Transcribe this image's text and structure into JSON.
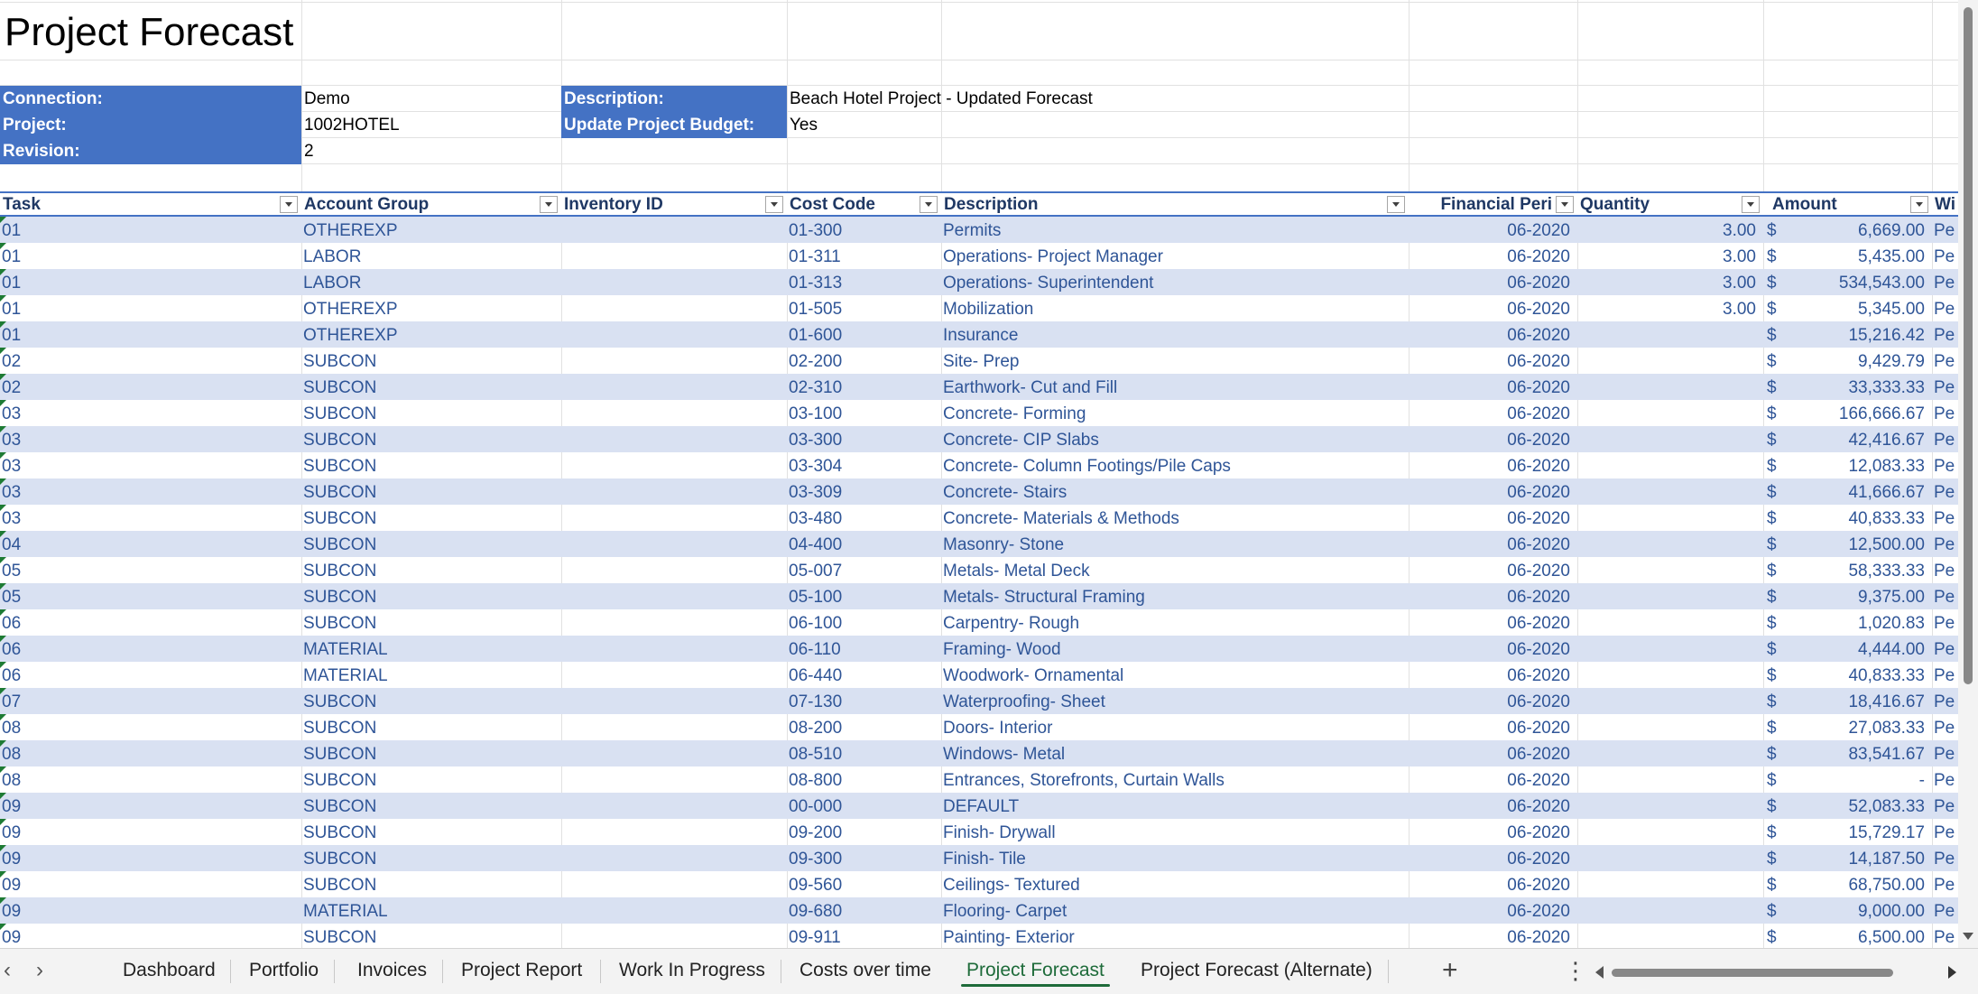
{
  "title": "Project Forecast",
  "info": {
    "connection_label": "Connection:",
    "connection_value": "Demo",
    "project_label": "Project:",
    "project_value": "1002HOTEL",
    "revision_label": "Revision:",
    "revision_value": "2",
    "description_label": "Description:",
    "description_value": "Beach Hotel Project - Updated Forecast",
    "update_budget_label": "Update Project Budget:",
    "update_budget_value": "Yes"
  },
  "table": {
    "headers": [
      "Task",
      "Account Group",
      "Inventory ID",
      "Cost Code",
      "Description",
      "Financial Peri",
      "Quantity",
      "Amount",
      "Wi"
    ],
    "currency_symbol": "$",
    "rows": [
      {
        "task": "01",
        "group": "OTHEREXP",
        "inv": "",
        "code": "01-300",
        "desc": "Permits",
        "period": "06-2020",
        "qty": "3.00",
        "amount": "6,669.00",
        "w": "Pe"
      },
      {
        "task": "01",
        "group": "LABOR",
        "inv": "",
        "code": "01-311",
        "desc": "Operations- Project Manager",
        "period": "06-2020",
        "qty": "3.00",
        "amount": "5,435.00",
        "w": "Pe"
      },
      {
        "task": "01",
        "group": "LABOR",
        "inv": "",
        "code": "01-313",
        "desc": "Operations- Superintendent",
        "period": "06-2020",
        "qty": "3.00",
        "amount": "534,543.00",
        "w": "Pe"
      },
      {
        "task": "01",
        "group": "OTHEREXP",
        "inv": "",
        "code": "01-505",
        "desc": "Mobilization",
        "period": "06-2020",
        "qty": "3.00",
        "amount": "5,345.00",
        "w": "Pe"
      },
      {
        "task": "01",
        "group": "OTHEREXP",
        "inv": "",
        "code": "01-600",
        "desc": "Insurance",
        "period": "06-2020",
        "qty": "",
        "amount": "15,216.42",
        "w": "Pe"
      },
      {
        "task": "02",
        "group": "SUBCON",
        "inv": "",
        "code": "02-200",
        "desc": "Site- Prep",
        "period": "06-2020",
        "qty": "",
        "amount": "9,429.79",
        "w": "Pe"
      },
      {
        "task": "02",
        "group": "SUBCON",
        "inv": "",
        "code": "02-310",
        "desc": "Earthwork- Cut and Fill",
        "period": "06-2020",
        "qty": "",
        "amount": "33,333.33",
        "w": "Pe"
      },
      {
        "task": "03",
        "group": "SUBCON",
        "inv": "",
        "code": "03-100",
        "desc": "Concrete- Forming",
        "period": "06-2020",
        "qty": "",
        "amount": "166,666.67",
        "w": "Pe"
      },
      {
        "task": "03",
        "group": "SUBCON",
        "inv": "",
        "code": "03-300",
        "desc": "Concrete- CIP Slabs",
        "period": "06-2020",
        "qty": "",
        "amount": "42,416.67",
        "w": "Pe"
      },
      {
        "task": "03",
        "group": "SUBCON",
        "inv": "",
        "code": "03-304",
        "desc": "Concrete- Column Footings/Pile Caps",
        "period": "06-2020",
        "qty": "",
        "amount": "12,083.33",
        "w": "Pe"
      },
      {
        "task": "03",
        "group": "SUBCON",
        "inv": "",
        "code": "03-309",
        "desc": "Concrete- Stairs",
        "period": "06-2020",
        "qty": "",
        "amount": "41,666.67",
        "w": "Pe"
      },
      {
        "task": "03",
        "group": "SUBCON",
        "inv": "",
        "code": "03-480",
        "desc": "Concrete- Materials & Methods",
        "period": "06-2020",
        "qty": "",
        "amount": "40,833.33",
        "w": "Pe"
      },
      {
        "task": "04",
        "group": "SUBCON",
        "inv": "",
        "code": "04-400",
        "desc": "Masonry- Stone",
        "period": "06-2020",
        "qty": "",
        "amount": "12,500.00",
        "w": "Pe"
      },
      {
        "task": "05",
        "group": "SUBCON",
        "inv": "",
        "code": "05-007",
        "desc": "Metals- Metal Deck",
        "period": "06-2020",
        "qty": "",
        "amount": "58,333.33",
        "w": "Pe"
      },
      {
        "task": "05",
        "group": "SUBCON",
        "inv": "",
        "code": "05-100",
        "desc": "Metals- Structural Framing",
        "period": "06-2020",
        "qty": "",
        "amount": "9,375.00",
        "w": "Pe"
      },
      {
        "task": "06",
        "group": "SUBCON",
        "inv": "",
        "code": "06-100",
        "desc": "Carpentry- Rough",
        "period": "06-2020",
        "qty": "",
        "amount": "1,020.83",
        "w": "Pe"
      },
      {
        "task": "06",
        "group": "MATERIAL",
        "inv": "",
        "code": "06-110",
        "desc": "Framing- Wood",
        "period": "06-2020",
        "qty": "",
        "amount": "4,444.00",
        "w": "Pe"
      },
      {
        "task": "06",
        "group": "MATERIAL",
        "inv": "",
        "code": "06-440",
        "desc": "Woodwork- Ornamental",
        "period": "06-2020",
        "qty": "",
        "amount": "40,833.33",
        "w": "Pe"
      },
      {
        "task": "07",
        "group": "SUBCON",
        "inv": "",
        "code": "07-130",
        "desc": "Waterproofing- Sheet",
        "period": "06-2020",
        "qty": "",
        "amount": "18,416.67",
        "w": "Pe"
      },
      {
        "task": "08",
        "group": "SUBCON",
        "inv": "",
        "code": "08-200",
        "desc": "Doors- Interior",
        "period": "06-2020",
        "qty": "",
        "amount": "27,083.33",
        "w": "Pe"
      },
      {
        "task": "08",
        "group": "SUBCON",
        "inv": "",
        "code": "08-510",
        "desc": "Windows- Metal",
        "period": "06-2020",
        "qty": "",
        "amount": "83,541.67",
        "w": "Pe"
      },
      {
        "task": "08",
        "group": "SUBCON",
        "inv": "",
        "code": "08-800",
        "desc": "Entrances, Storefronts, Curtain Walls",
        "period": "06-2020",
        "qty": "",
        "amount": "-",
        "w": "Pe"
      },
      {
        "task": "09",
        "group": "SUBCON",
        "inv": "",
        "code": "00-000",
        "desc": "DEFAULT",
        "period": "06-2020",
        "qty": "",
        "amount": "52,083.33",
        "w": "Pe"
      },
      {
        "task": "09",
        "group": "SUBCON",
        "inv": "",
        "code": "09-200",
        "desc": "Finish- Drywall",
        "period": "06-2020",
        "qty": "",
        "amount": "15,729.17",
        "w": "Pe"
      },
      {
        "task": "09",
        "group": "SUBCON",
        "inv": "",
        "code": "09-300",
        "desc": "Finish- Tile",
        "period": "06-2020",
        "qty": "",
        "amount": "14,187.50",
        "w": "Pe"
      },
      {
        "task": "09",
        "group": "SUBCON",
        "inv": "",
        "code": "09-560",
        "desc": "Ceilings- Textured",
        "period": "06-2020",
        "qty": "",
        "amount": "68,750.00",
        "w": "Pe"
      },
      {
        "task": "09",
        "group": "MATERIAL",
        "inv": "",
        "code": "09-680",
        "desc": "Flooring- Carpet",
        "period": "06-2020",
        "qty": "",
        "amount": "9,000.00",
        "w": "Pe"
      },
      {
        "task": "09",
        "group": "SUBCON",
        "inv": "",
        "code": "09-911",
        "desc": "Painting- Exterior",
        "period": "06-2020",
        "qty": "",
        "amount": "6,500.00",
        "w": "Pe"
      }
    ]
  },
  "tabs": [
    {
      "label": "Dashboard",
      "active": false
    },
    {
      "label": "Portfolio",
      "active": false
    },
    {
      "label": "Invoices",
      "active": false
    },
    {
      "label": "Project Report",
      "active": false
    },
    {
      "label": "Work In Progress",
      "active": false
    },
    {
      "label": "Costs over time",
      "active": false
    },
    {
      "label": "Project Forecast",
      "active": true
    },
    {
      "label": "Project Forecast (Alternate)",
      "active": false
    }
  ],
  "tabbar_icons": {
    "prev": "chevron-left-icon",
    "next": "chevron-right-icon",
    "add": "plus-icon",
    "more": "more-vertical-icon"
  },
  "colors": {
    "header_accent": "#4472c4",
    "band_row": "#d9e1f2",
    "cell_text": "#2f5597",
    "active_tab": "#1e6b3a"
  }
}
